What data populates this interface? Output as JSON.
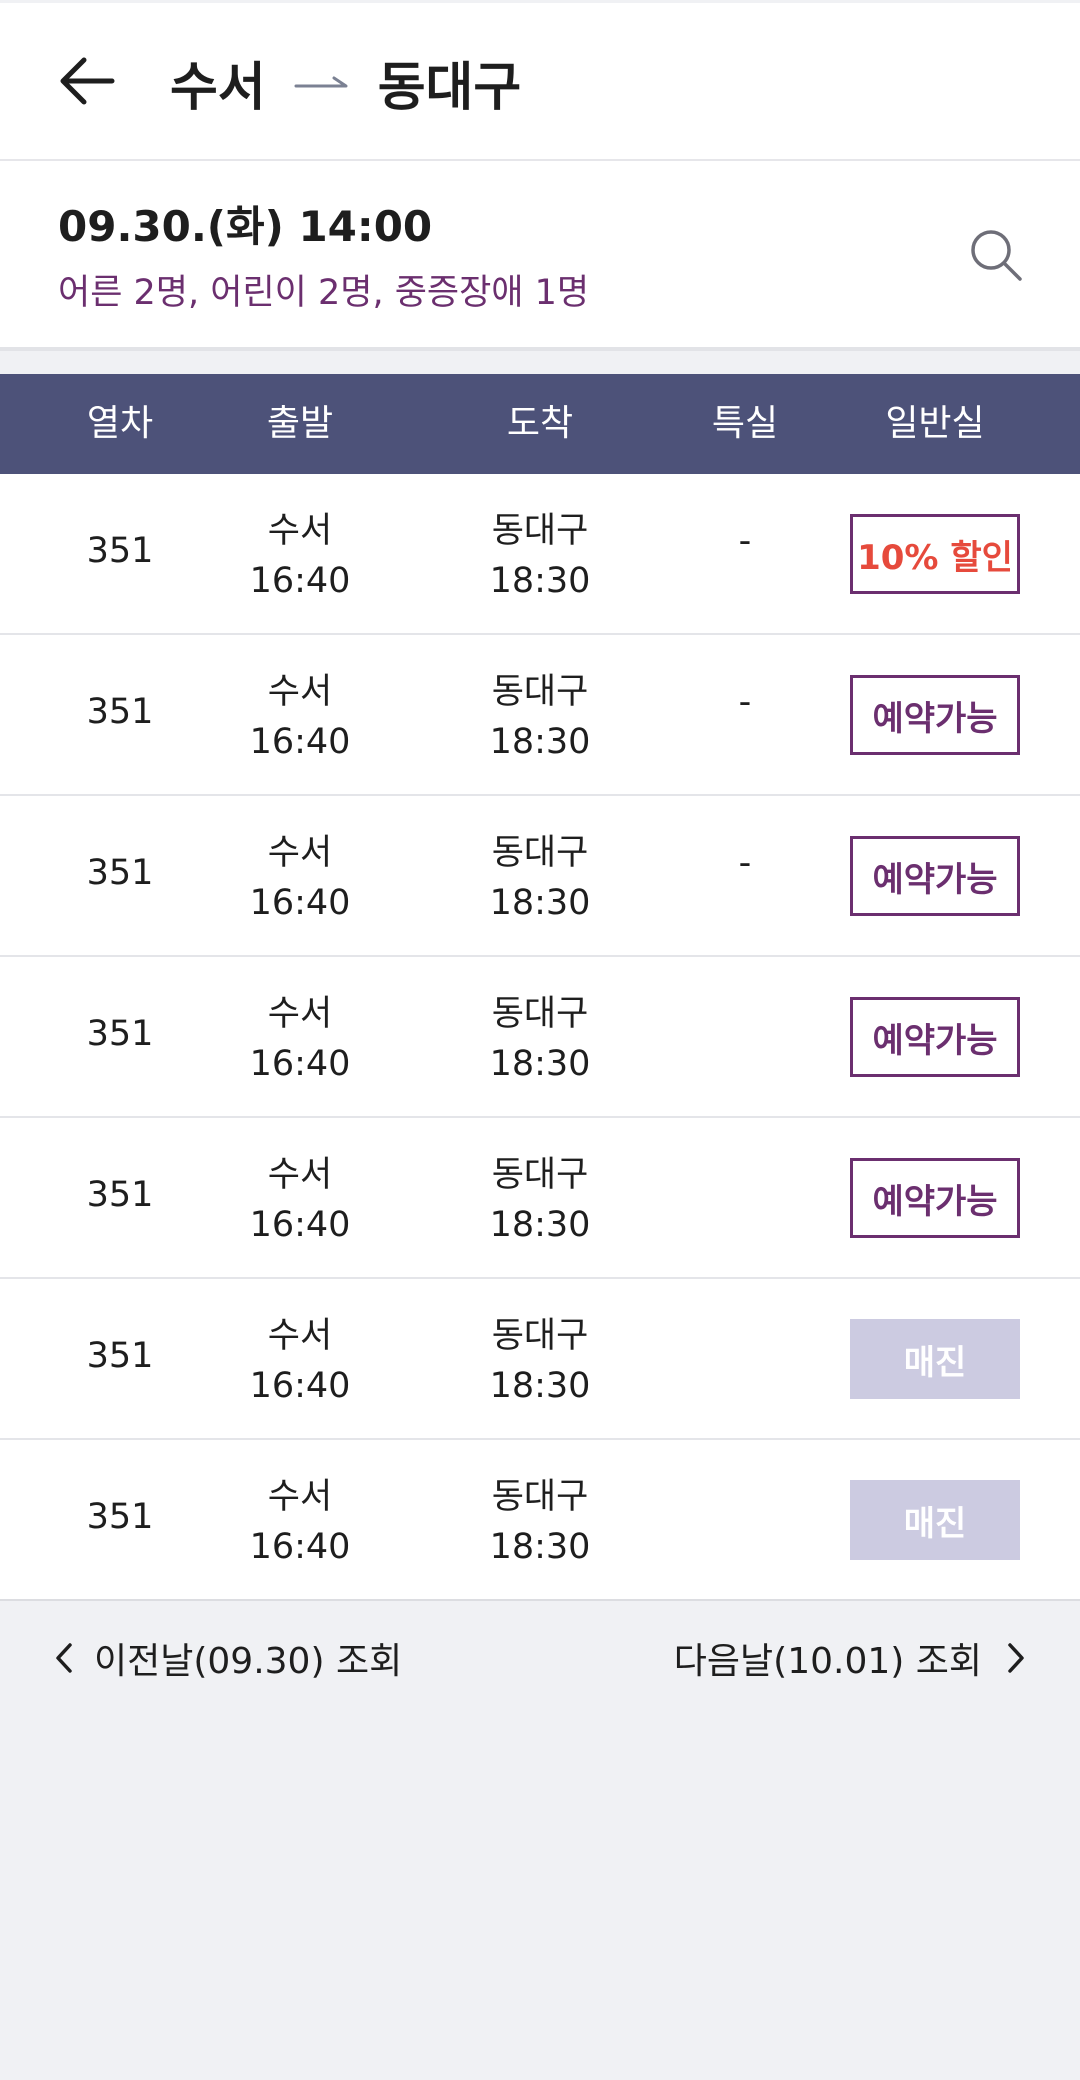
{
  "header": {
    "origin": "수서",
    "destination": "동대구"
  },
  "summary": {
    "datetime": "09.30.(화) 14:00",
    "passengers": "어른 2명, 어린이 2명, 중증장애 1명"
  },
  "table": {
    "columns": [
      "열차",
      "출발",
      "도착",
      "특실",
      "일반실"
    ],
    "rows": [
      {
        "train": "351",
        "dep_station": "수서",
        "dep_time": "16:40",
        "arr_station": "동대구",
        "arr_time": "18:30",
        "special": "-",
        "general": "10% 할인",
        "general_state": "discount"
      },
      {
        "train": "351",
        "dep_station": "수서",
        "dep_time": "16:40",
        "arr_station": "동대구",
        "arr_time": "18:30",
        "special": "-",
        "general": "예약가능",
        "general_state": "available"
      },
      {
        "train": "351",
        "dep_station": "수서",
        "dep_time": "16:40",
        "arr_station": "동대구",
        "arr_time": "18:30",
        "special": "-",
        "general": "예약가능",
        "general_state": "available"
      },
      {
        "train": "351",
        "dep_station": "수서",
        "dep_time": "16:40",
        "arr_station": "동대구",
        "arr_time": "18:30",
        "special": "",
        "general": "예약가능",
        "general_state": "available"
      },
      {
        "train": "351",
        "dep_station": "수서",
        "dep_time": "16:40",
        "arr_station": "동대구",
        "arr_time": "18:30",
        "special": "",
        "general": "예약가능",
        "general_state": "available"
      },
      {
        "train": "351",
        "dep_station": "수서",
        "dep_time": "16:40",
        "arr_station": "동대구",
        "arr_time": "18:30",
        "special": "",
        "general": "매진",
        "general_state": "soldout"
      },
      {
        "train": "351",
        "dep_station": "수서",
        "dep_time": "16:40",
        "arr_station": "동대구",
        "arr_time": "18:30",
        "special": "",
        "general": "매진",
        "general_state": "soldout"
      }
    ]
  },
  "footer": {
    "prev_label": "이전날(09.30) 조회",
    "next_label": "다음날(10.01) 조회"
  },
  "colors": {
    "header_bg": "#4d5279",
    "accent_purple": "#6b2f6f",
    "discount_red": "#e64a3c",
    "soldout_bg": "#cccbe1",
    "page_bg": "#f0f1f4"
  },
  "icons": {
    "back": "arrow-left-icon",
    "route": "route-arrow-icon",
    "search": "search-icon",
    "prev": "chevron-left-icon",
    "next": "chevron-right-icon"
  }
}
